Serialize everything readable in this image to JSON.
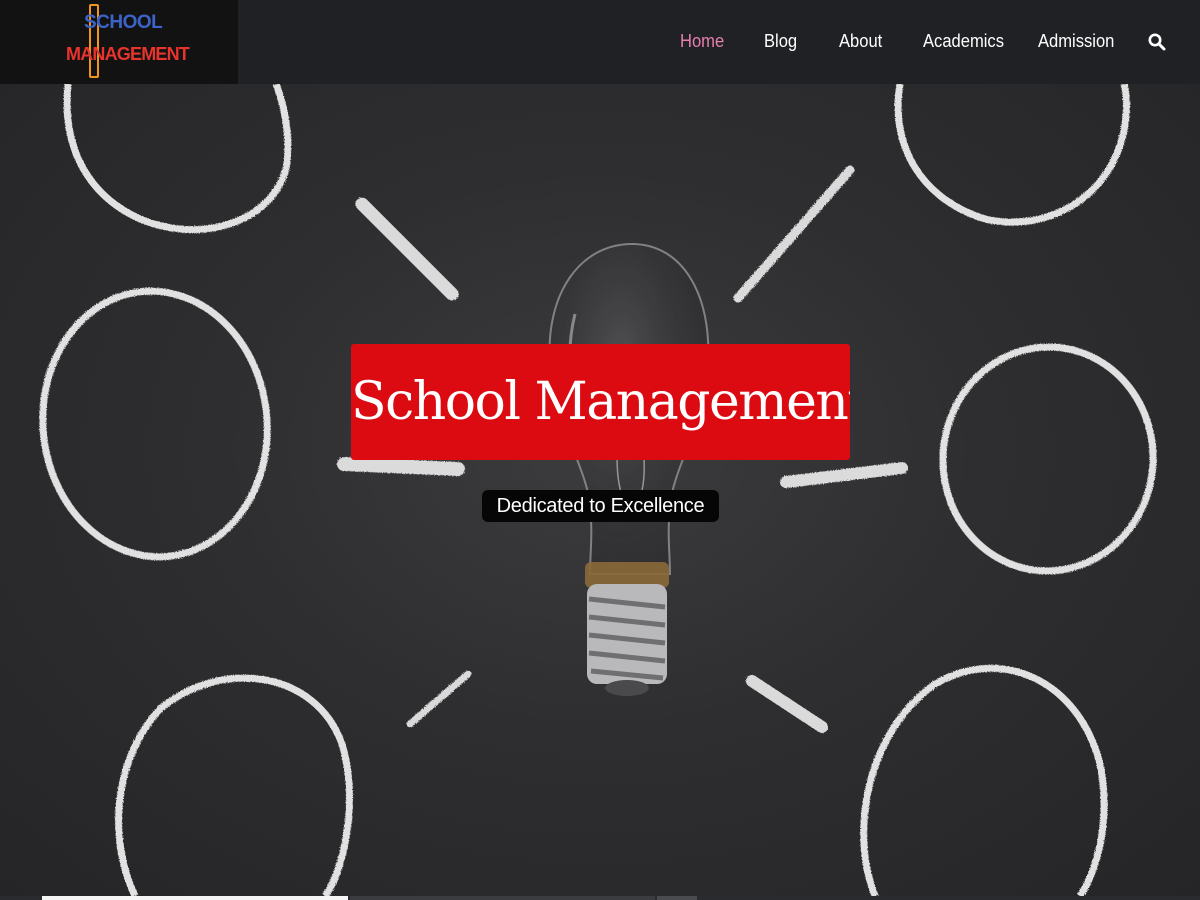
{
  "header": {
    "logo": {
      "line1": "SCHOOL",
      "line2": "MANAGEMENT"
    },
    "nav": [
      {
        "label": "Home",
        "active": true
      },
      {
        "label": "Blog",
        "active": false
      },
      {
        "label": "About",
        "active": false
      },
      {
        "label": "Academics",
        "active": false
      },
      {
        "label": "Admission",
        "active": false
      }
    ],
    "search_icon": "search-icon"
  },
  "hero": {
    "title": "School Management",
    "subtitle": "Dedicated to Excellence",
    "background": "chalkboard-lightbulb"
  },
  "colors": {
    "accent_red": "#dc0b12",
    "nav_active": "#e97fb1",
    "topbar": "#1f2124"
  }
}
